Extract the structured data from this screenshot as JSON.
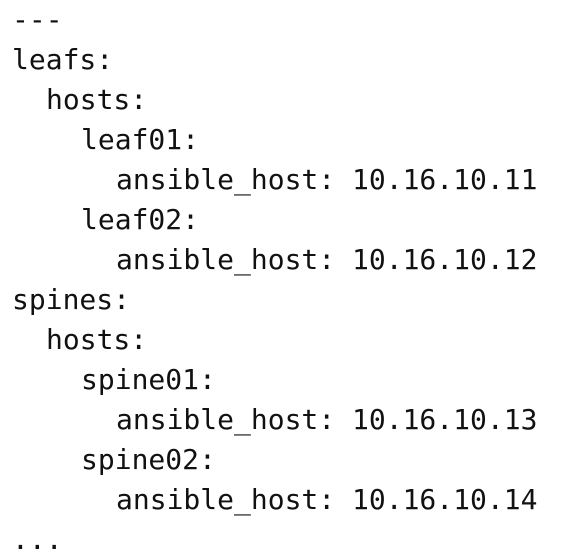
{
  "document": {
    "lines": [
      "---",
      "leafs:",
      "hosts:",
      "leaf01:",
      "ansible_host: 10.16.10.11",
      "leaf02:",
      "ansible_host: 10.16.10.12",
      "spines:",
      "hosts:",
      "spine01:",
      "ansible_host: 10.16.10.13",
      "spine02:",
      "ansible_host: 10.16.10.14",
      "..."
    ]
  }
}
